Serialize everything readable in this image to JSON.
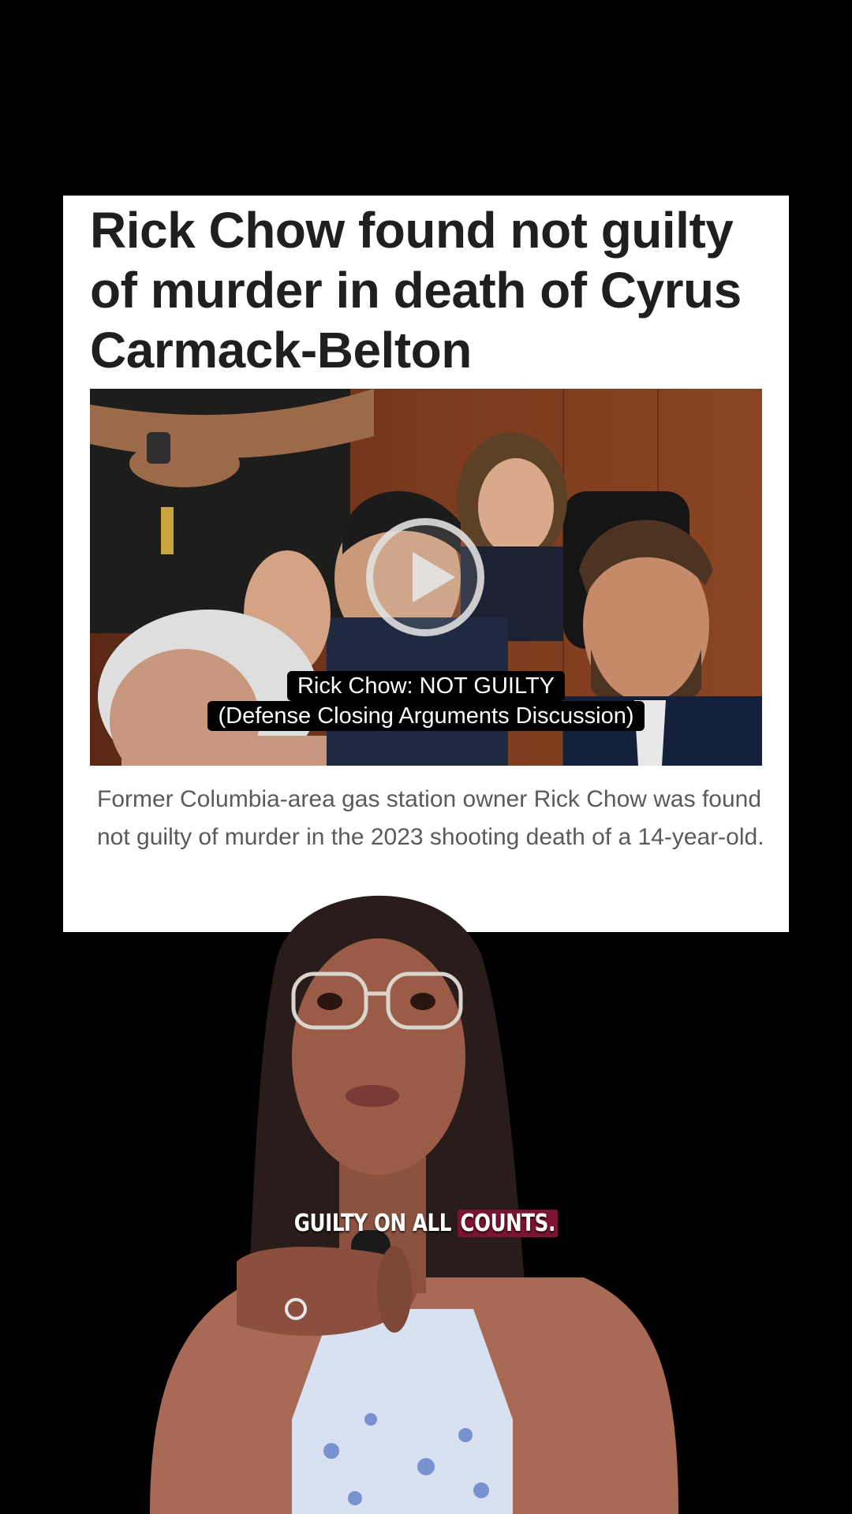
{
  "article": {
    "headline": "Rick Chow found not guilty of murder in death of Cyrus Carmack-Belton",
    "video": {
      "caption_line1": "Rick Chow: NOT GUILTY",
      "caption_line2": "(Defense Closing Arguments Discussion)",
      "play_icon": "play-icon"
    },
    "summary": "Former Columbia-area gas station owner Rick Chow was found not guilty of murder in the 2023 shooting death of a 14-year-old."
  },
  "subtitle": {
    "words_before": "GUILTY ON ALL",
    "highlighted_word": "COUNTS.",
    "highlight_color": "#7b1430"
  },
  "colors": {
    "background": "#000000",
    "card": "#ffffff",
    "headline": "#1f1f1f",
    "summary": "#5a5a5a"
  }
}
